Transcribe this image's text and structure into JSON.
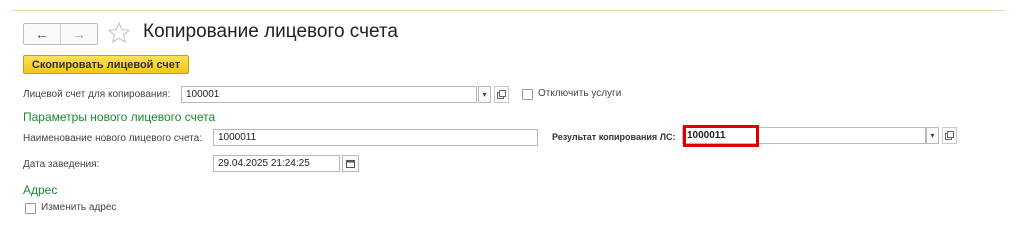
{
  "window": {
    "title": "Копирование лицевого счета"
  },
  "nav": {
    "back_glyph": "←",
    "forward_glyph": "→",
    "favorite_icon": "star-outline-icon"
  },
  "toolbar": {
    "copy_button_label": "Скопировать лицевой счет"
  },
  "copy_source": {
    "label": "Лицевой счет для копирования:",
    "value": "100001",
    "disable_services_label": "Отключить услуги",
    "disable_services_checked": false
  },
  "new_account": {
    "section_title": "Параметры нового лицевого счета",
    "name_label": "Наименование нового лицевого счета:",
    "name_value": "1000011",
    "date_label": "Дата заведения:",
    "date_value": "29.04.2025 21:24:25"
  },
  "result": {
    "label": "Результат копирования ЛС:",
    "value": "1000011"
  },
  "address": {
    "section_title": "Адрес",
    "change_label": "Изменить адрес",
    "change_checked": false
  },
  "colors": {
    "section_title": "#1a8a2e",
    "highlight_border": "#e00000",
    "button_fill": "#f5d327"
  }
}
